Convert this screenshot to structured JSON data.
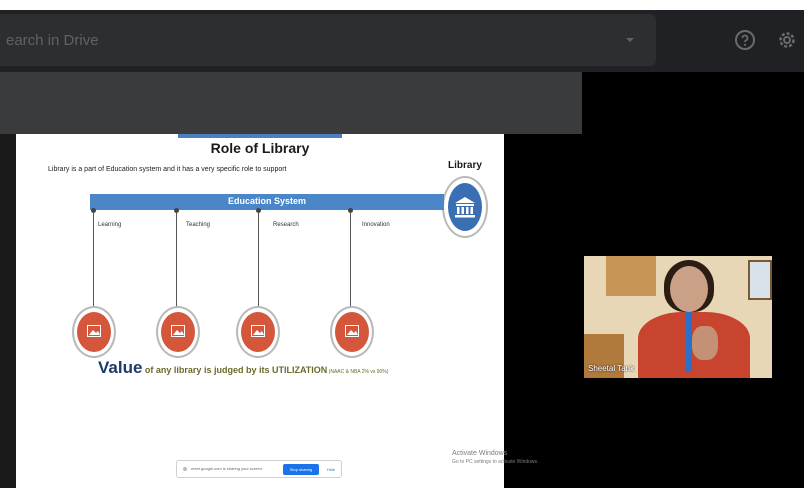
{
  "drive": {
    "search_placeholder": "earch in Drive",
    "icons": [
      "caret-down-icon",
      "help-icon",
      "gear-icon"
    ]
  },
  "slide": {
    "title": "Role of Library",
    "subtitle": "Library is a part of Education system and it has a very specific role to support",
    "library_label": "Library",
    "education_bar": "Education System",
    "branches": [
      "Learning",
      "Teaching",
      "Research",
      "Innovation"
    ],
    "value_word": "Value",
    "value_rest": " of any library is judged by its UTILIZATION",
    "value_small": " (NAAC & NBA 2% vs 90%)",
    "colors": {
      "accent_blue": "#4a86c8",
      "circle_red": "#d4573c",
      "value_navy": "#1f3a6b"
    }
  },
  "share_bar": {
    "message": "meet.google.com is sharing your screen.",
    "stop_label": "Stop sharing",
    "hide_label": "Hide"
  },
  "watermark": {
    "line1": "Activate Windows",
    "line2": "Go to PC settings to activate Windows."
  },
  "video": {
    "participant_name": "Sheetal Tank"
  }
}
